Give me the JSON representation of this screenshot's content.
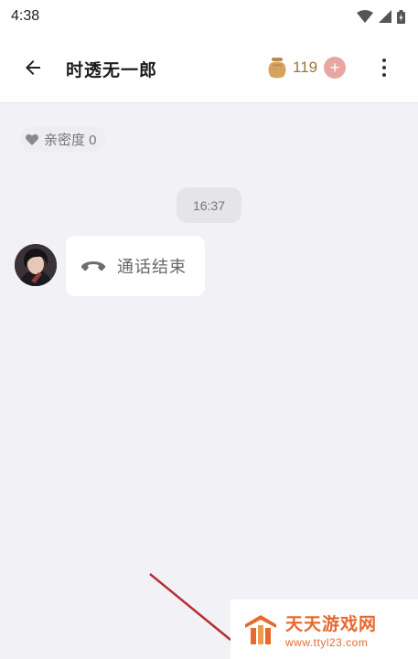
{
  "status_bar": {
    "time": "4:38"
  },
  "header": {
    "title": "时透无一郎",
    "coin_count": "119",
    "add_symbol": "+"
  },
  "chat": {
    "intimacy_label": "亲密度 0",
    "timestamp": "16:37",
    "call_message": "通话结束"
  },
  "watermark": {
    "title": "天天游戏网",
    "url": "www.ttyl23.com"
  },
  "colors": {
    "accent_coin": "#a0753a",
    "add_button": "#e7a6a2",
    "watermark": "#e8692e",
    "background": "#f2f1f6"
  },
  "icons": [
    "back-arrow-icon",
    "coin-jar-icon",
    "more-vert-icon",
    "heart-icon",
    "phone-hangup-icon",
    "wifi-icon",
    "signal-icon",
    "battery-icon"
  ]
}
